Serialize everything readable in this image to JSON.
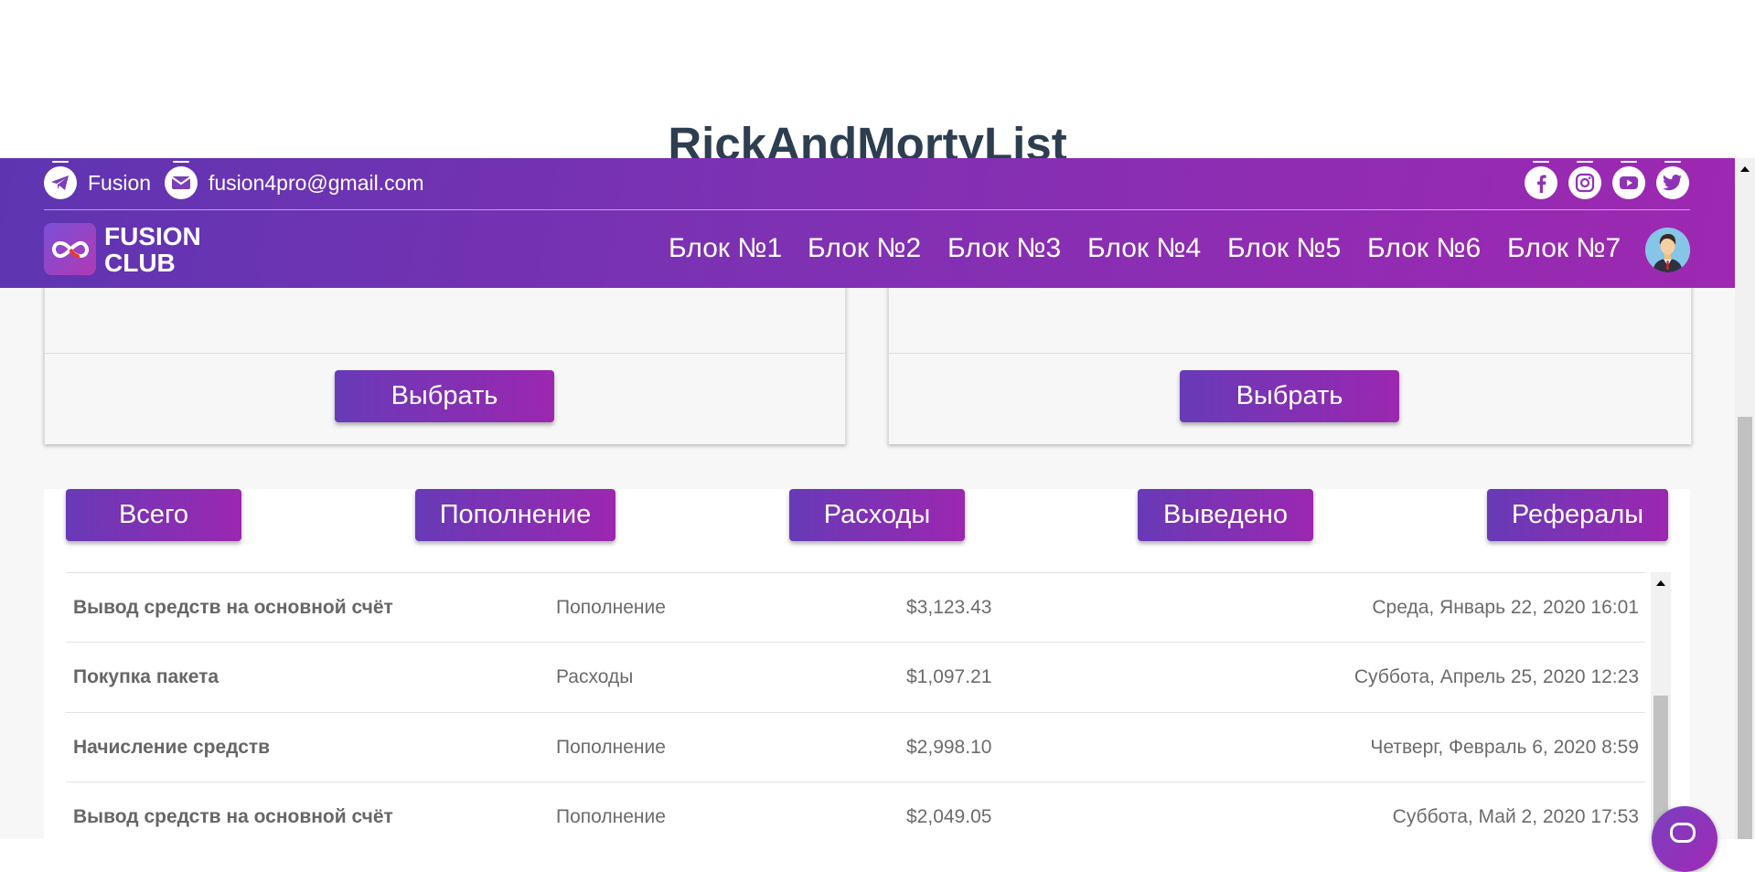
{
  "page": {
    "title": "RickAndMortyList"
  },
  "topbar": {
    "telegram_label": "Fusion",
    "email": "fusion4pro@gmail.com",
    "socials": [
      "facebook-icon",
      "instagram-icon",
      "youtube-icon",
      "twitter-icon"
    ]
  },
  "nav": {
    "logo_line1": "FUSION",
    "logo_line2": "CLUB",
    "items": [
      {
        "label": "Блок №1"
      },
      {
        "label": "Блок №2"
      },
      {
        "label": "Блок №3"
      },
      {
        "label": "Блок №4"
      },
      {
        "label": "Блок №5"
      },
      {
        "label": "Блок №6"
      },
      {
        "label": "Блок №7"
      }
    ]
  },
  "cards": [
    {
      "button": "Выбрать"
    },
    {
      "button": "Выбрать"
    }
  ],
  "tabs": [
    {
      "label": "Всего"
    },
    {
      "label": "Пополнение"
    },
    {
      "label": "Расходы"
    },
    {
      "label": "Выведено"
    },
    {
      "label": "Рефералы"
    }
  ],
  "transactions": [
    {
      "name": "Вывод средств на основной счёт",
      "type": "Пополнение",
      "amount": "$3,123.43",
      "date": "Среда, Январь 22, 2020 16:01"
    },
    {
      "name": "Покупка пакета",
      "type": "Расходы",
      "amount": "$1,097.21",
      "date": "Суббота, Апрель 25, 2020 12:23"
    },
    {
      "name": "Начисление средств",
      "type": "Пополнение",
      "amount": "$2,998.10",
      "date": "Четверг, Февраль 6, 2020 8:59"
    },
    {
      "name": "Вывод средств на основной счёт",
      "type": "Пополнение",
      "amount": "$2,049.05",
      "date": "Суббота, Май 2, 2020 17:53"
    }
  ],
  "colors": {
    "gradient_start": "#673ab7",
    "gradient_end": "#9c27b0",
    "title": "#2c3e50"
  }
}
